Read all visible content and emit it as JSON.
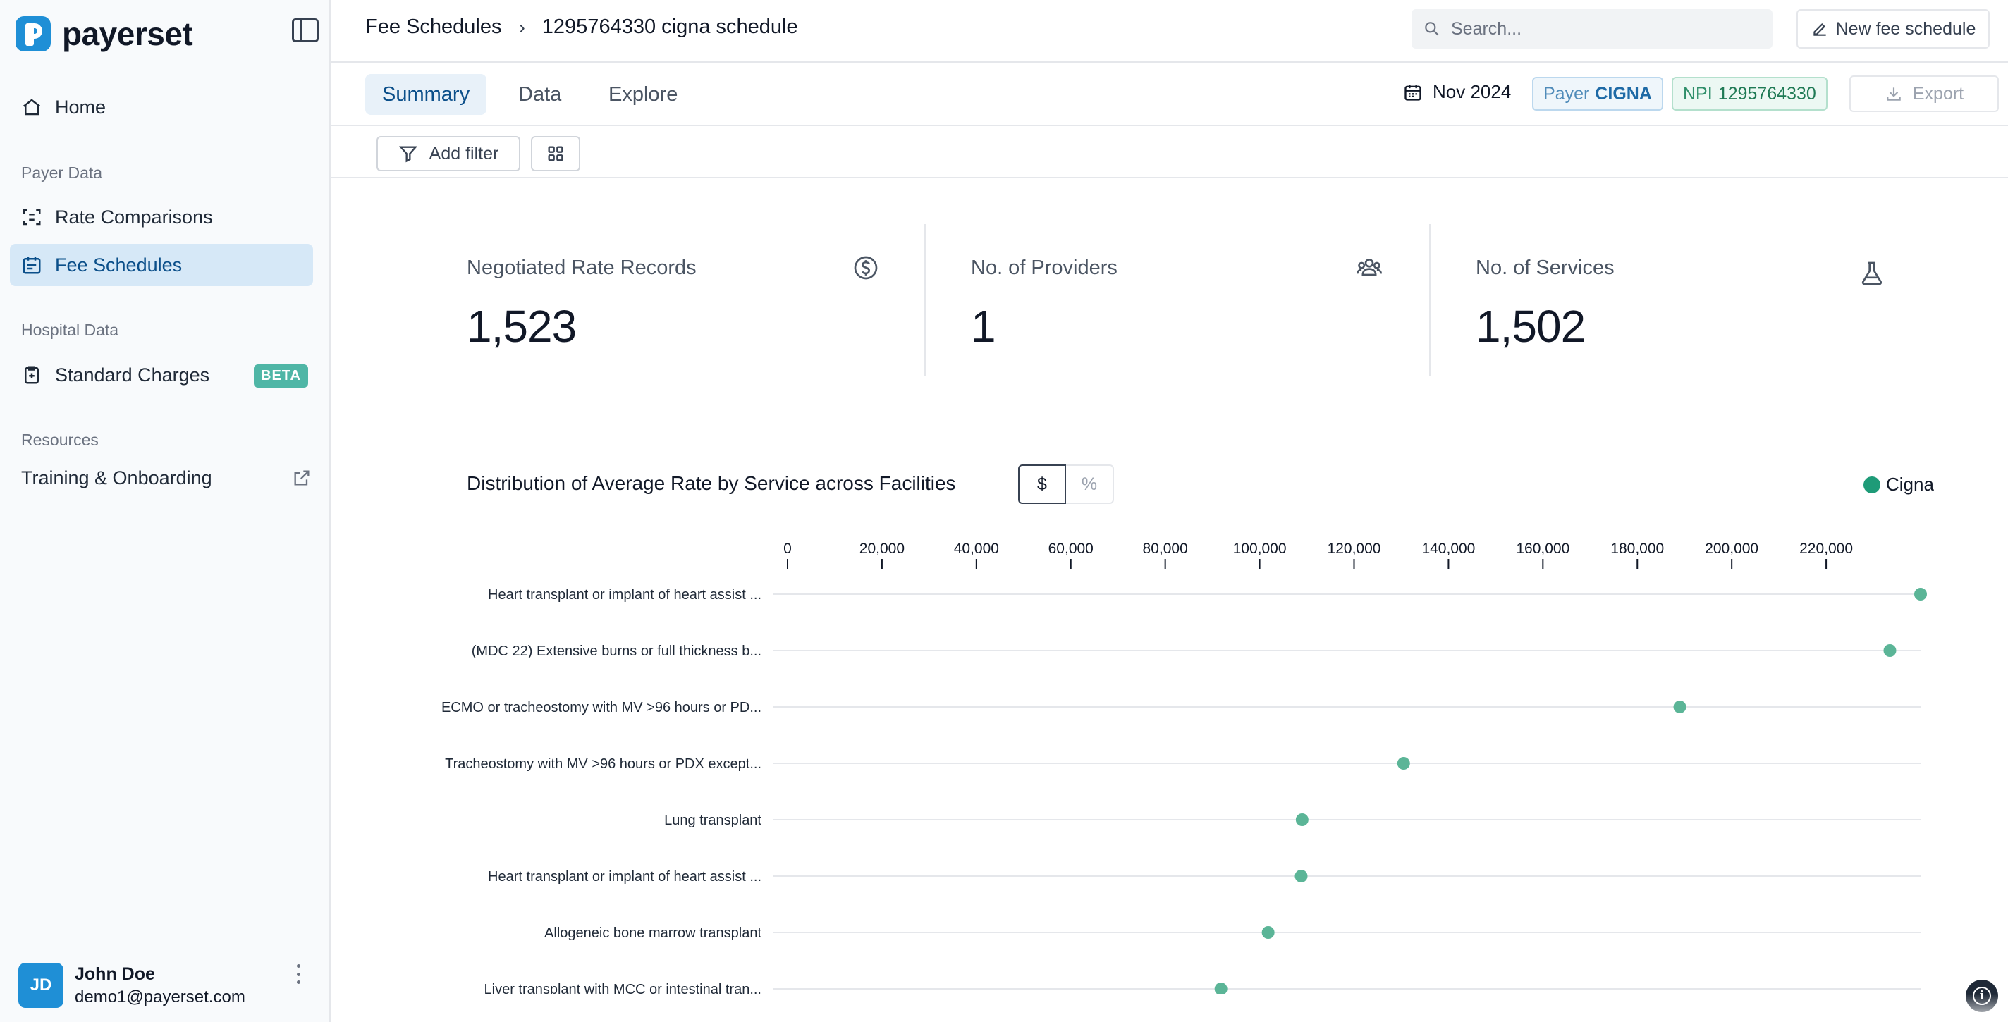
{
  "brand": {
    "name": "payerset"
  },
  "sidebar": {
    "home": "Home",
    "payer_section": "Payer Data",
    "rate_comparisons": "Rate Comparisons",
    "fee_schedules": "Fee Schedules",
    "hospital_section": "Hospital Data",
    "standard_charges": "Standard Charges",
    "beta_badge": "BETA",
    "resources_section": "Resources",
    "training": "Training & Onboarding"
  },
  "user": {
    "initials": "JD",
    "name": "John Doe",
    "email": "demo1@payerset.com"
  },
  "header": {
    "breadcrumb_root": "Fee Schedules",
    "breadcrumb_current": "1295764330 cigna schedule",
    "search_placeholder": "Search...",
    "new_button": "New fee schedule"
  },
  "tabs": [
    {
      "label": "Summary",
      "active": true
    },
    {
      "label": "Data",
      "active": false
    },
    {
      "label": "Explore",
      "active": false
    }
  ],
  "toolbar": {
    "date": "Nov 2024",
    "payer_label": "Payer",
    "payer_value": "CIGNA",
    "npi_label": "NPI",
    "npi_value": "1295764330",
    "export": "Export",
    "add_filter": "Add filter"
  },
  "stats": [
    {
      "label": "Negotiated Rate Records",
      "value": "1,523",
      "icon": "dollar-icon"
    },
    {
      "label": "No. of Providers",
      "value": "1",
      "icon": "users-icon"
    },
    {
      "label": "No. of Services",
      "value": "1,502",
      "icon": "flask-icon"
    }
  ],
  "chart_section": {
    "title": "Distribution of Average Rate by Service across Facilities",
    "toggle_dollar": "$",
    "toggle_percent": "%",
    "legend": "Cigna"
  },
  "chart_data": {
    "type": "scatter",
    "orientation": "horizontal",
    "title": "Distribution of Average Rate by Service across Facilities",
    "xlim": [
      0,
      240000
    ],
    "x_ticks": [
      "0",
      "20,000",
      "40,000",
      "60,000",
      "80,000",
      "100,000",
      "120,000",
      "140,000",
      "160,000",
      "180,000",
      "200,000",
      "220,000"
    ],
    "x_tick_values": [
      0,
      20000,
      40000,
      60000,
      80000,
      100000,
      120000,
      140000,
      160000,
      180000,
      200000,
      220000
    ],
    "series": [
      {
        "name": "Cigna",
        "color": "#5bb597",
        "points": [
          {
            "label": "Heart transplant or implant of heart assist ...",
            "value": 240000
          },
          {
            "label": "(MDC 22) Extensive burns or full thickness b...",
            "value": 233500
          },
          {
            "label": "ECMO or tracheostomy with MV >96 hours or PD...",
            "value": 189000
          },
          {
            "label": "Tracheostomy with MV >96 hours or PDX except...",
            "value": 130500
          },
          {
            "label": "Lung transplant",
            "value": 109000
          },
          {
            "label": "Heart transplant or implant of heart assist ...",
            "value": 108800
          },
          {
            "label": "Allogeneic bone marrow transplant",
            "value": 101800
          },
          {
            "label": "Liver transplant with MCC or intestinal tran...",
            "value": 91800
          }
        ]
      }
    ]
  }
}
